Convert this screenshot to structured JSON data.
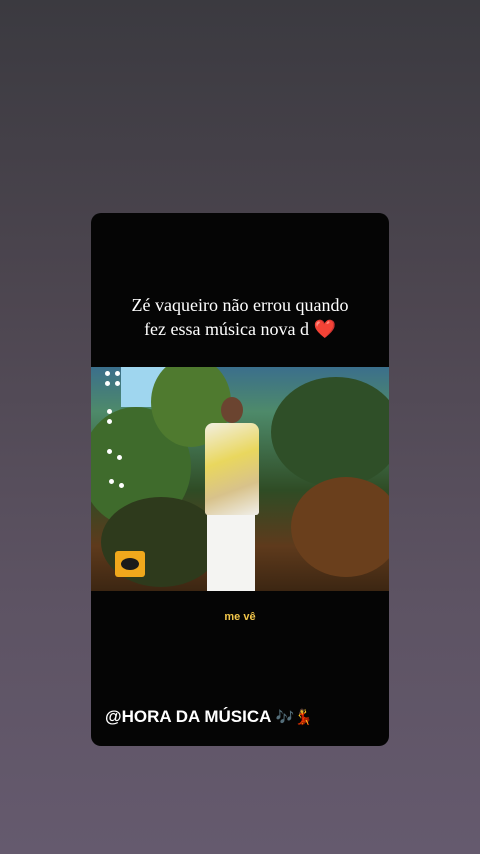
{
  "post": {
    "caption_line1": "Zé vaqueiro não errou quando",
    "caption_line2": "fez essa música nova d",
    "caption_emoji": "❤️",
    "subtitle": "me vê",
    "handle": "@HORA DA MÚSICA",
    "handle_emojis": "🎶💃"
  }
}
